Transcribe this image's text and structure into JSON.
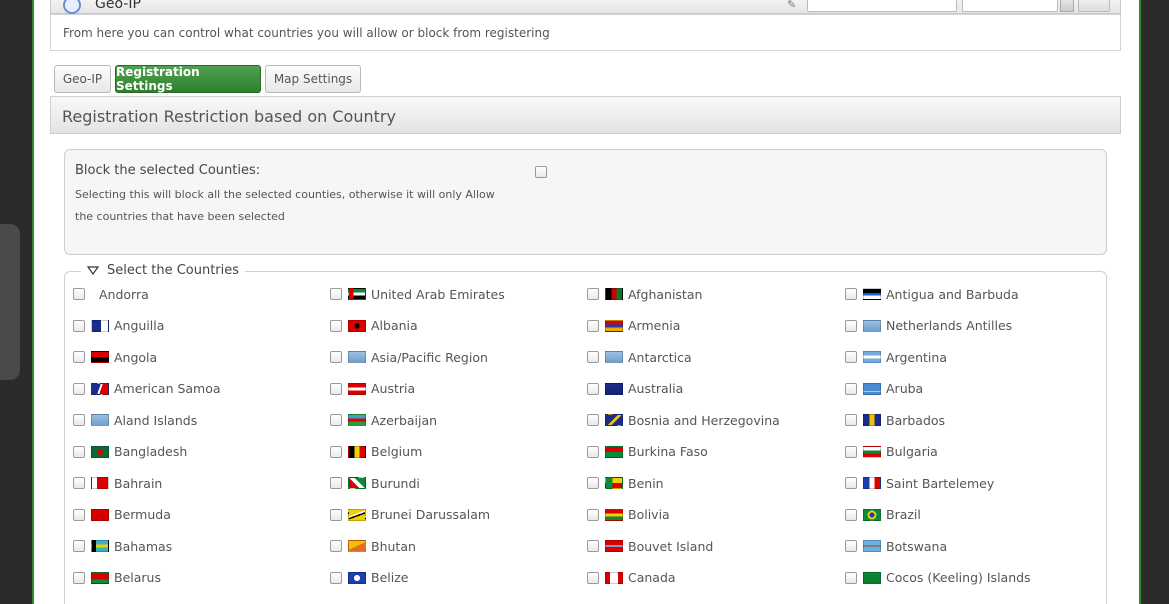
{
  "header": {
    "title": "Geo-IP",
    "description": "From here you can control what countries you will allow or block from registering"
  },
  "tabs": [
    {
      "label": "Geo-IP",
      "active": false
    },
    {
      "label": "Registration Settings",
      "active": true
    },
    {
      "label": "Map Settings",
      "active": false
    }
  ],
  "section": {
    "title": "Registration Restriction based on Country"
  },
  "block": {
    "label": "Block the selected Counties:",
    "help": "Selecting this will block all the selected counties, otherwise it will only Allow the countries that have been selected",
    "checked": false
  },
  "countries": {
    "legend": "Select the Countries",
    "items": [
      {
        "name": "Andorra",
        "flag": ""
      },
      {
        "name": "United Arab Emirates",
        "flag": "linear-gradient(90deg,#d00 0 28%,transparent 28%),linear-gradient(#0a8a3a 0 33%,#fff 33% 66%,#000 66%)"
      },
      {
        "name": "Afghanistan",
        "flag": "linear-gradient(90deg,#000 0 33%,#c00 33% 66%,#0a7a2a 66%)"
      },
      {
        "name": "Antigua and Barbuda",
        "flag": "linear-gradient(#000 0 40%,#1a5bd6 40% 65%,#fff 65%)"
      },
      {
        "name": "Anguilla",
        "flag": "linear-gradient(90deg,#1a2c8c 0 55%,#fff 55%)"
      },
      {
        "name": "Albania",
        "flag": "radial-gradient(circle,#000 0 25%,#d00 30%)"
      },
      {
        "name": "Armenia",
        "flag": "linear-gradient(#d00 0 33%,#1a3fb0 33% 66%,#f2a800 66%)"
      },
      {
        "name": "Netherlands Antilles",
        "flag": "linear-gradient(#9cc0e0,#6fa0d0)"
      },
      {
        "name": "Angola",
        "flag": "linear-gradient(#d00 0 50%,#000 50%)"
      },
      {
        "name": "Asia/Pacific Region",
        "flag": "linear-gradient(#9cc0e0,#6fa0d0)"
      },
      {
        "name": "Antarctica",
        "flag": "linear-gradient(#9cc0e0,#6fa0d0)"
      },
      {
        "name": "Argentina",
        "flag": "linear-gradient(#74acdf 0 33%,#fff 33% 66%,#74acdf 66%)"
      },
      {
        "name": "American Samoa",
        "flag": "linear-gradient(110deg,#1a2c8c 0 45%,#fff 45% 55%,#d00 55%)"
      },
      {
        "name": "Austria",
        "flag": "linear-gradient(#d00 0 33%,#fff 33% 66%,#d00 66%)"
      },
      {
        "name": "Australia",
        "flag": "linear-gradient(#1a2c8c,#13236e)"
      },
      {
        "name": "Aruba",
        "flag": "linear-gradient(#4a8ad0 0 70%,#f2d000 70% 80%,#4a8ad0 80%)"
      },
      {
        "name": "Aland Islands",
        "flag": "linear-gradient(#9cc0e0,#6fa0d0)"
      },
      {
        "name": "Azerbaijan",
        "flag": "linear-gradient(#3aa0d0 0 33%,#d00 33% 66%,#2a9a3a 66%)"
      },
      {
        "name": "Bosnia and Herzegovina",
        "flag": "linear-gradient(135deg,#1a2c8c 0 45%,#f2c200 45% 60%,#1a2c8c 60%)"
      },
      {
        "name": "Barbados",
        "flag": "linear-gradient(90deg,#1a2c8c 0 33%,#f2c200 33% 66%,#1a2c8c 66%)"
      },
      {
        "name": "Bangladesh",
        "flag": "radial-gradient(circle,#d00 0 30%,#0a6a3a 34%)"
      },
      {
        "name": "Belgium",
        "flag": "linear-gradient(90deg,#000 0 33%,#f2d000 33% 66%,#d00 66%)"
      },
      {
        "name": "Burkina Faso",
        "flag": "linear-gradient(#d00 0 50%,#0a8a3a 50%)"
      },
      {
        "name": "Bulgaria",
        "flag": "linear-gradient(#fff 0 33%,#0a8a3a 33% 66%,#d00 66%)"
      },
      {
        "name": "Bahrain",
        "flag": "linear-gradient(90deg,#fff 0 30%,#d00 30%)"
      },
      {
        "name": "Burundi",
        "flag": "linear-gradient(45deg,#d00 0 40%,#fff 40% 60%,#0a8a3a 60%)"
      },
      {
        "name": "Benin",
        "flag": "linear-gradient(90deg,#0a8a3a 0 40%,transparent 40%),linear-gradient(#f2d000 0 50%,#d00 50%)"
      },
      {
        "name": "Saint Bartelemey",
        "flag": "linear-gradient(90deg,#1a3fb0 0 33%,#fff 33% 66%,#d00 66%)"
      },
      {
        "name": "Bermuda",
        "flag": "linear-gradient(#d00,#c00)"
      },
      {
        "name": "Brunei Darussalam",
        "flag": "linear-gradient(160deg,#f2d000 0 40%,#fff 40% 50%,#000 50% 60%,#f2d000 60%)"
      },
      {
        "name": "Bolivia",
        "flag": "linear-gradient(#d00 0 33%,#f2d000 33% 66%,#0a8a3a 66%)"
      },
      {
        "name": "Brazil",
        "flag": "radial-gradient(circle,#1a3fb0 0 25%,#f2d000 28% 45%,#0a8a3a 48%)"
      },
      {
        "name": "Bahamas",
        "flag": "linear-gradient(90deg,#000 0 25%,transparent 25%),linear-gradient(#3ab0c8 0 33%,#f2d000 33% 66%,#3ab0c8 66%)"
      },
      {
        "name": "Bhutan",
        "flag": "linear-gradient(155deg,#f2c200 0 50%,#e07020 50%)"
      },
      {
        "name": "Bouvet Island",
        "flag": "linear-gradient(#d00 0 40%,#fff 40% 45%,#1a2c8c 45% 55%,#fff 55% 60%,#d00 60%)"
      },
      {
        "name": "Botswana",
        "flag": "linear-gradient(#6ab0e0 0 40%,#fff 40% 45%,#000 45% 55%,#fff 55% 60%,#6ab0e0 60%)"
      },
      {
        "name": "Belarus",
        "flag": "linear-gradient(#d00 0 65%,#0a8a3a 65%)"
      },
      {
        "name": "Belize",
        "flag": "radial-gradient(circle,#fff 0 30%,#1a3fb0 34%)"
      },
      {
        "name": "Canada",
        "flag": "linear-gradient(90deg,#d00 0 25%,#fff 25% 75%,#d00 75%)"
      },
      {
        "name": "Cocos (Keeling) Islands",
        "flag": "linear-gradient(#0a8a3a,#0a7a2a)"
      }
    ]
  }
}
